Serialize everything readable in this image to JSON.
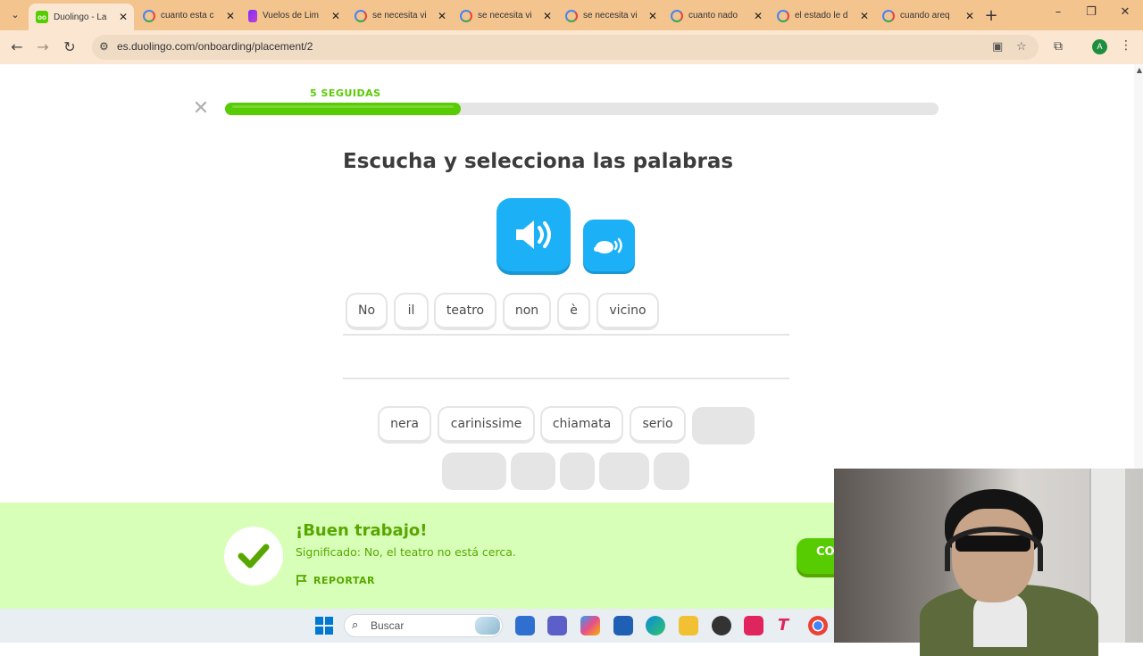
{
  "browser": {
    "tabs": [
      {
        "label": "Duolingo - La",
        "favicon": "duolingo-icon",
        "active": true
      },
      {
        "label": "cuanto esta c",
        "favicon": "google-icon"
      },
      {
        "label": "Vuelos de Lim",
        "favicon": "flights-icon"
      },
      {
        "label": "se necesita vi",
        "favicon": "google-icon"
      },
      {
        "label": "se necesita vi",
        "favicon": "google-icon"
      },
      {
        "label": "se necesita vi",
        "favicon": "google-icon"
      },
      {
        "label": "cuanto nado",
        "favicon": "google-icon"
      },
      {
        "label": "el estado le d",
        "favicon": "google-icon"
      },
      {
        "label": "cuando areq",
        "favicon": "google-icon"
      }
    ],
    "url": "es.duolingo.com/onboarding/placement/2",
    "profile_initial": "A"
  },
  "lesson": {
    "streak_label": "5 SEGUIDAS",
    "progress": 0.33,
    "title": "Escucha y selecciona las palabras",
    "selected_words": [
      "No",
      "il",
      "teatro",
      "non",
      "è",
      "vicino"
    ],
    "word_bank": [
      "nera",
      "carinissime",
      "chiamata",
      "serio"
    ]
  },
  "feedback": {
    "title": "¡Buen trabajo!",
    "meaning": "Significado: No, el teatro no está cerca.",
    "report": "REPORTAR",
    "continue": "CONTINUAR"
  },
  "taskbar": {
    "search_placeholder": "Buscar"
  },
  "colors": {
    "accent_green": "#58cc02",
    "blue": "#1cb0f6",
    "banner": "#d7ffb8",
    "browser_frame": "#f4c48f"
  }
}
